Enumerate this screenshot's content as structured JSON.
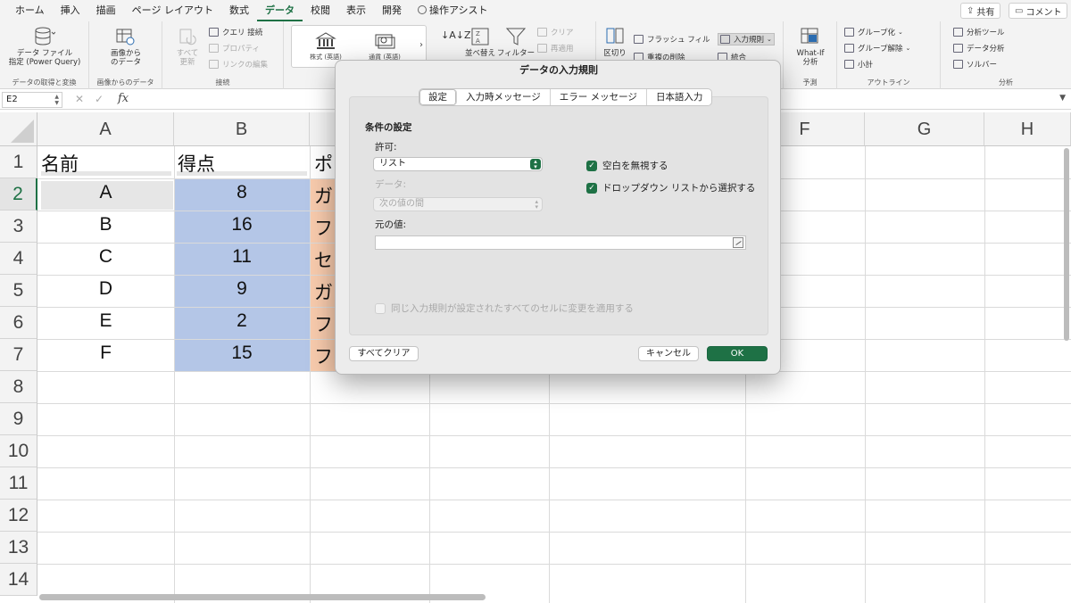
{
  "ribbon_tabs": [
    "ホーム",
    "挿入",
    "描画",
    "ページ レイアウト",
    "数式",
    "データ",
    "校閲",
    "表示",
    "開発",
    "操作アシスト"
  ],
  "active_tab": "データ",
  "share_label": "共有",
  "comment_label": "コメント",
  "ribbon": {
    "get_data_label": "データ ファイル\n指定 (Power Query)",
    "get_data_group": "データの取得と変換",
    "image_data_label": "画像から\nのデータ",
    "image_data_group": "画像からのデータ",
    "refresh_all_label": "すべて\n更新",
    "queries_label": "クエリ 接続",
    "properties_label": "プロパティ",
    "edit_links_label": "リンクの編集",
    "connections_group": "接続",
    "stocks_label": "株式 (英語)",
    "currency_label": "通貨 (英語)",
    "sort_label": "並べ替え",
    "filter_label": "フィルター",
    "clear_label": "クリア",
    "reapply_label": "再適用",
    "flash_fill_label": "フラッシュ フィル",
    "text_to_columns_label": "区切り",
    "remove_dupes_label": "重複の削除",
    "data_validation_label": "入力規則",
    "consolidate_label": "統合",
    "whatif_label": "What-If\n分析",
    "forecast_group": "予測",
    "group_label": "グループ化",
    "ungroup_label": "グループ解除",
    "subtotal_label": "小計",
    "outline_group": "アウトライン",
    "analysis_tools_label": "分析ツール",
    "data_analysis_label": "データ分析",
    "solver_label": "ソルバー",
    "analysis_group": "分析"
  },
  "formula_bar": {
    "name_box": "E2",
    "fx_label": "fx"
  },
  "grid": {
    "columns": [
      "A",
      "B",
      "C",
      "D",
      "E",
      "F",
      "G",
      "H"
    ],
    "rows": [
      "1",
      "2",
      "3",
      "4",
      "5",
      "6",
      "7",
      "8",
      "9",
      "10",
      "11",
      "12",
      "13",
      "14"
    ],
    "header_row": [
      "名前",
      "得点",
      "ポ"
    ],
    "data_rows": [
      {
        "name": "A",
        "score": "8",
        "c": "ガ"
      },
      {
        "name": "B",
        "score": "16",
        "c": "フ"
      },
      {
        "name": "C",
        "score": "11",
        "c": "セ"
      },
      {
        "name": "D",
        "score": "9",
        "c": "ガ"
      },
      {
        "name": "E",
        "score": "2",
        "c": "フ"
      },
      {
        "name": "F",
        "score": "15",
        "c": "フ"
      }
    ],
    "colors": {
      "score_fill": "#b4c6e7",
      "c_fill": "#f8cbad",
      "selected_fill": "#e6e6e6"
    }
  },
  "dialog": {
    "title": "データの入力規則",
    "tabs": [
      "設定",
      "入力時メッセージ",
      "エラー メッセージ",
      "日本語入力"
    ],
    "active_tab": "設定",
    "section_title": "条件の設定",
    "allow_label": "許可:",
    "allow_value": "リスト",
    "data_label": "データ:",
    "data_value": "次の値の間",
    "ignore_blank_label": "空白を無視する",
    "dropdown_label": "ドロップダウン リストから選択する",
    "source_label": "元の値:",
    "source_value": "",
    "apply_all_label": "同じ入力規則が設定されたすべてのセルに変更を適用する",
    "clear_all_label": "すべてクリア",
    "cancel_label": "キャンセル",
    "ok_label": "OK"
  },
  "accent_color": "#1e7145"
}
